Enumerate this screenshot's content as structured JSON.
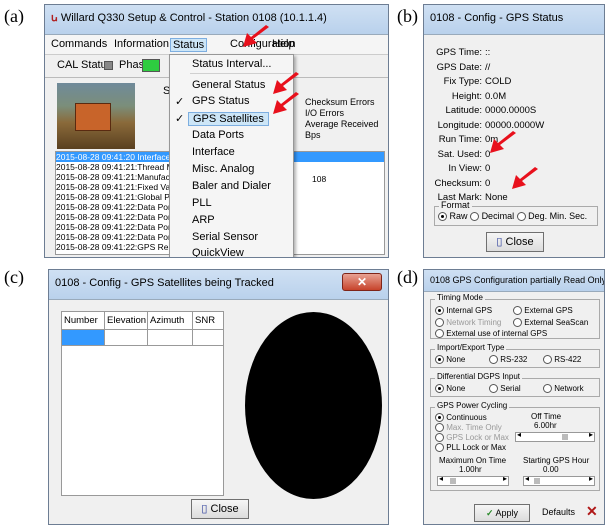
{
  "labels": {
    "a": "(a)",
    "b": "(b)",
    "c": "(c)",
    "d": "(d)"
  },
  "colors": {
    "arrow": "#e8101c",
    "accent_blue": "#3399ff",
    "phase_green": "#2ecc40"
  },
  "win_a": {
    "title": "Willard Q330 Setup & Control - Station 0108 (10.1.1.4)",
    "menus": [
      "Commands",
      "Information",
      "Status",
      "Configuration",
      "Help"
    ],
    "cal_status_label": "CAL Status",
    "phase_label": "Phase",
    "status_menu": [
      "Status Interval...",
      "General Status",
      "GPS Status",
      "GPS Satellites",
      "Data Ports",
      "Interface",
      "Misc. Analog",
      "Baler and Dialer",
      "PLL",
      "ARP",
      "Serial Sensor",
      "QuickView"
    ],
    "right_info": [
      "Checksum Errors",
      "I/O Errors",
      "Average Received Bps"
    ],
    "st_label": "St",
    "log_lines": [
      "2015-08-28 09:41:20 Interface",
      "2015-08-28 09:41:21:Thread M",
      "2015-08-28 09:41:21:Manufac",
      "2015-08-28 09:41:21:Fixed Val",
      "2015-08-28 09:41:21:Global Pr",
      "2015-08-28 09:41:22:Data Por",
      "2015-08-28 09:41:22:Data Por",
      "2015-08-28 09:41:22:Data Por",
      "2015-08-28 09:41:22:Data Por",
      "2015-08-28 09:41:22:GPS Re"
    ],
    "log_suffix": "108"
  },
  "win_b": {
    "title": "0108 - Config - GPS Status",
    "rows": [
      {
        "label": "GPS Time:",
        "value": "::"
      },
      {
        "label": "GPS Date:",
        "value": "//"
      },
      {
        "label": "Fix Type:",
        "value": "COLD"
      },
      {
        "label": "Height:",
        "value": "0.0M"
      },
      {
        "label": "Latitude:",
        "value": "0000.0000S"
      },
      {
        "label": "Longitude:",
        "value": "00000.0000W"
      },
      {
        "label": "Run Time:",
        "value": "0m"
      },
      {
        "label": "Sat. Used:",
        "value": "0"
      },
      {
        "label": "In View:",
        "value": "0"
      },
      {
        "label": "Checksum:",
        "value": "0"
      },
      {
        "label": "Last Mark:",
        "value": "None"
      }
    ],
    "format_legend": "Format",
    "format_options": [
      "Raw",
      "Decimal",
      "Deg. Min. Sec."
    ],
    "close_label": "Close"
  },
  "win_c": {
    "title": "0108 - Config - GPS Satellites being Tracked",
    "columns": [
      "Number",
      "Elevation",
      "Azimuth",
      "SNR"
    ],
    "close_label": "Close"
  },
  "win_d": {
    "title": "0108 GPS Configuration partially Read Only",
    "timing": {
      "legend": "Timing Mode",
      "options": [
        "Internal GPS",
        "External GPS",
        "Network Timing",
        "External SeaScan",
        "External use of internal GPS"
      ]
    },
    "import_export": {
      "legend": "Import/Export Type",
      "options": [
        "None",
        "RS-232",
        "RS-422"
      ]
    },
    "dgps": {
      "legend": "Differential DGPS Input",
      "options": [
        "None",
        "Serial",
        "Network"
      ]
    },
    "power": {
      "legend": "GPS Power Cycling",
      "options": [
        "Continuous",
        "Max. Time Only",
        "GPS Lock or Max",
        "PLL Lock or Max"
      ],
      "off_time_label": "Off Time",
      "off_time_value": "6.00hr",
      "max_on_label": "Maximum On Time",
      "max_on_value": "1.00hr",
      "start_hour_label": "Starting GPS Hour",
      "start_hour_value": "0.00"
    },
    "apply_label": "Apply",
    "defaults_label": "Defaults",
    "cancel_label": "✕"
  }
}
